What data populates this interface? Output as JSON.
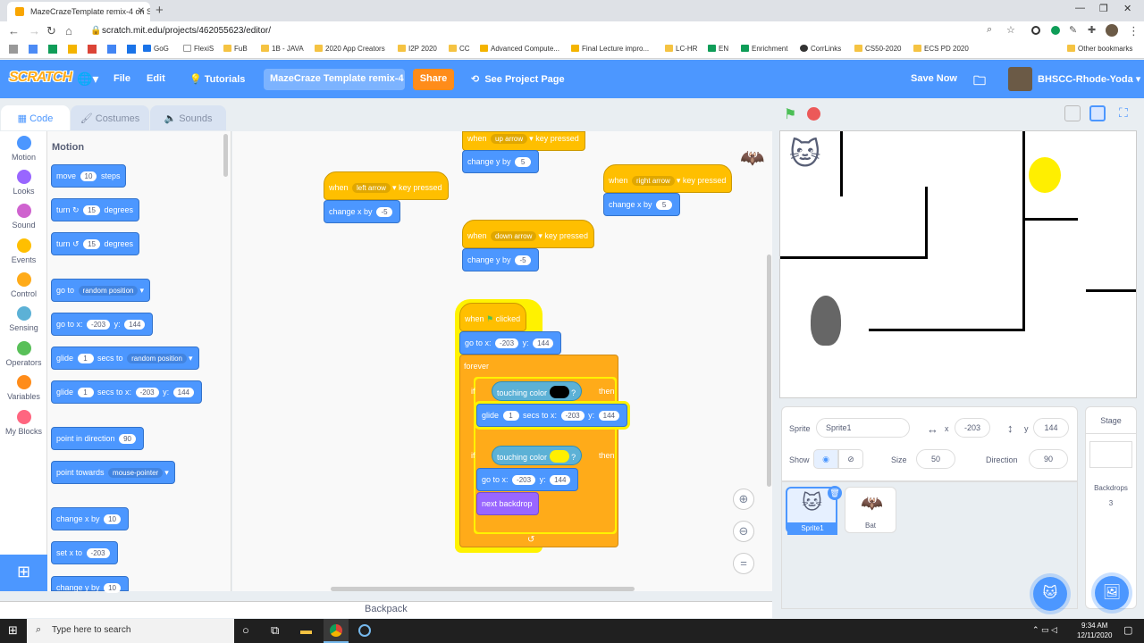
{
  "browser": {
    "tab_title": "MazeCrazeTemplate remix-4 on Scratch",
    "url": "scratch.mit.edu/projects/462055623/editor/",
    "bookmarks": [
      "GoG",
      "FlexiS",
      "FuB",
      "1B - JAVA",
      "2020 App Creators",
      "I2P 2020",
      "CC",
      "Advanced Compute...",
      "Final Lecture impro...",
      "LC-HR",
      "EN",
      "Enrichment",
      "CorrLinks",
      "CS50-2020",
      "ECS PD 2020"
    ],
    "other_bookmarks": "Other bookmarks"
  },
  "menu": {
    "logo": "SCRATCH",
    "file": "File",
    "edit": "Edit",
    "tutorials": "Tutorials",
    "project_title": "MazeCraze Template remix-4",
    "share": "Share",
    "see_project": "See Project Page",
    "save_now": "Save Now",
    "user": "BHSCC-Rhode-Yoda"
  },
  "editor_tabs": {
    "code": "Code",
    "costumes": "Costumes",
    "sounds": "Sounds"
  },
  "categories": [
    {
      "label": "Motion",
      "color": "#4c97ff"
    },
    {
      "label": "Looks",
      "color": "#9966ff"
    },
    {
      "label": "Sound",
      "color": "#cf63cf"
    },
    {
      "label": "Events",
      "color": "#ffbf00"
    },
    {
      "label": "Control",
      "color": "#ffab19"
    },
    {
      "label": "Sensing",
      "color": "#5cb1d6"
    },
    {
      "label": "Operators",
      "color": "#59c059"
    },
    {
      "label": "Variables",
      "color": "#ff8c1a"
    },
    {
      "label": "My Blocks",
      "color": "#ff6680"
    }
  ],
  "palette": {
    "heading": "Motion",
    "move": {
      "a": "move",
      "v": "10",
      "b": "steps"
    },
    "turn_r": {
      "a": "turn",
      "v": "15",
      "b": "degrees"
    },
    "turn_l": {
      "a": "turn",
      "v": "15",
      "b": "degrees"
    },
    "goto": {
      "a": "go to",
      "d": "random position"
    },
    "gotoxy": {
      "a": "go to x:",
      "x": "-203",
      "b": "y:",
      "y": "144"
    },
    "glide": {
      "a": "glide",
      "v": "1",
      "b": "secs to",
      "d": "random position"
    },
    "glidexy": {
      "a": "glide",
      "v": "1",
      "b": "secs to x:",
      "x": "-203",
      "c": "y:",
      "y": "144"
    },
    "point": {
      "a": "point in direction",
      "v": "90"
    },
    "towards": {
      "a": "point towards",
      "d": "mouse-pointer"
    },
    "changex": {
      "a": "change x by",
      "v": "10"
    },
    "setx": {
      "a": "set x to",
      "v": "-203"
    },
    "changey": {
      "a": "change y by",
      "v": "10"
    }
  },
  "scripts": {
    "up": {
      "when": "when",
      "key": "up arrow",
      "pressed": "key pressed",
      "change": "change y by",
      "v": "5"
    },
    "left": {
      "when": "when",
      "key": "left arrow",
      "pressed": "key pressed",
      "change": "change x by",
      "v": "-5"
    },
    "right": {
      "when": "when",
      "key": "right arrow",
      "pressed": "key pressed",
      "change": "change x by",
      "v": "5"
    },
    "down": {
      "when": "when",
      "key": "down arrow",
      "pressed": "key pressed",
      "change": "change y by",
      "v": "-5"
    },
    "flag": {
      "when": "when",
      "clicked": "clicked",
      "goto": "go to x:",
      "x": "-203",
      "y_lbl": "y:",
      "y": "144",
      "forever": "forever",
      "if1": "if",
      "touching": "touching color",
      "then": "then",
      "color1": "#000000",
      "glide": "glide",
      "gv": "1",
      "secs": "secs to x:",
      "gx": "-203",
      "gy_lbl": "y:",
      "gy": "144",
      "if2": "if",
      "color2": "#ffef00",
      "goto2": "go to x:",
      "x2": "-203",
      "y2_lbl": "y:",
      "y2": "144",
      "next": "next backdrop"
    }
  },
  "backpack": "Backpack",
  "sprite_info": {
    "sprite_label": "Sprite",
    "name": "Sprite1",
    "x_label": "x",
    "x": "-203",
    "y_label": "y",
    "y": "144",
    "show": "Show",
    "size_label": "Size",
    "size": "50",
    "dir_label": "Direction",
    "dir": "90"
  },
  "sprites": [
    {
      "name": "Sprite1"
    },
    {
      "name": "Bat"
    }
  ],
  "stage_panel": {
    "title": "Stage",
    "backdrops_label": "Backdrops",
    "backdrops": "3"
  },
  "taskbar": {
    "search": "Type here to search",
    "time": "9:34 AM",
    "date": "12/11/2020"
  }
}
